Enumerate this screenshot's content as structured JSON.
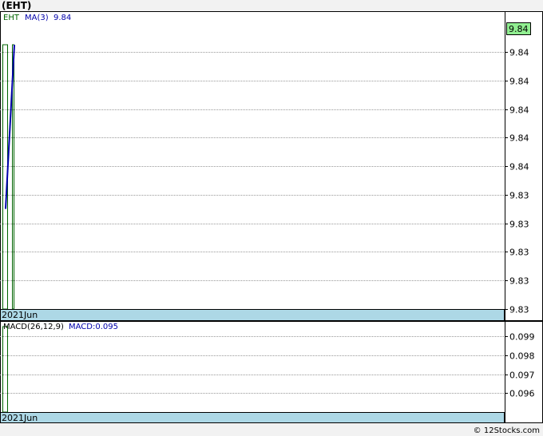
{
  "title": "(EHT)",
  "footer": "© 12Stocks.com",
  "colors": {
    "price_up": "#006400",
    "ma_line": "#0000aa",
    "axis_band": "#add8e6",
    "grid": "#999999",
    "last_value_bg": "#90ee90",
    "macd_label": "#000000",
    "macd_value": "#0000aa"
  },
  "chart_data": [
    {
      "type": "line",
      "legend": [
        {
          "name": "EHT",
          "color": "#006400"
        },
        {
          "name": "MA(3)",
          "value": "9.84",
          "color": "#0000aa"
        }
      ],
      "x_label": "2021Jun",
      "y_tick_labels": [
        "9.84",
        "9.84",
        "9.84",
        "9.84",
        "9.84",
        "9.83",
        "9.83",
        "9.83",
        "9.83",
        "9.83"
      ],
      "last_value_label": "9.84",
      "ylim": [
        9.826,
        9.845
      ],
      "bars": [
        {
          "x": 0,
          "low": 9.826,
          "high": 9.8435
        },
        {
          "x": 1,
          "low": 9.826,
          "high": 9.8435
        }
      ],
      "series": [
        {
          "name": "MA(3)",
          "x": [
            0,
            1
          ],
          "y": [
            9.8325,
            9.8435
          ]
        }
      ],
      "grid": true
    },
    {
      "type": "bar",
      "legend": [
        {
          "name": "MACD(26,12,9)"
        },
        {
          "name": "MACD:",
          "value": "0.095"
        }
      ],
      "x_label": "2021Jun",
      "y_tick_labels": [
        "0.099",
        "0.098",
        "0.097",
        "0.096"
      ],
      "ylim": [
        0.0945,
        0.1
      ],
      "values": [
        0.0995
      ],
      "grid": true
    }
  ]
}
